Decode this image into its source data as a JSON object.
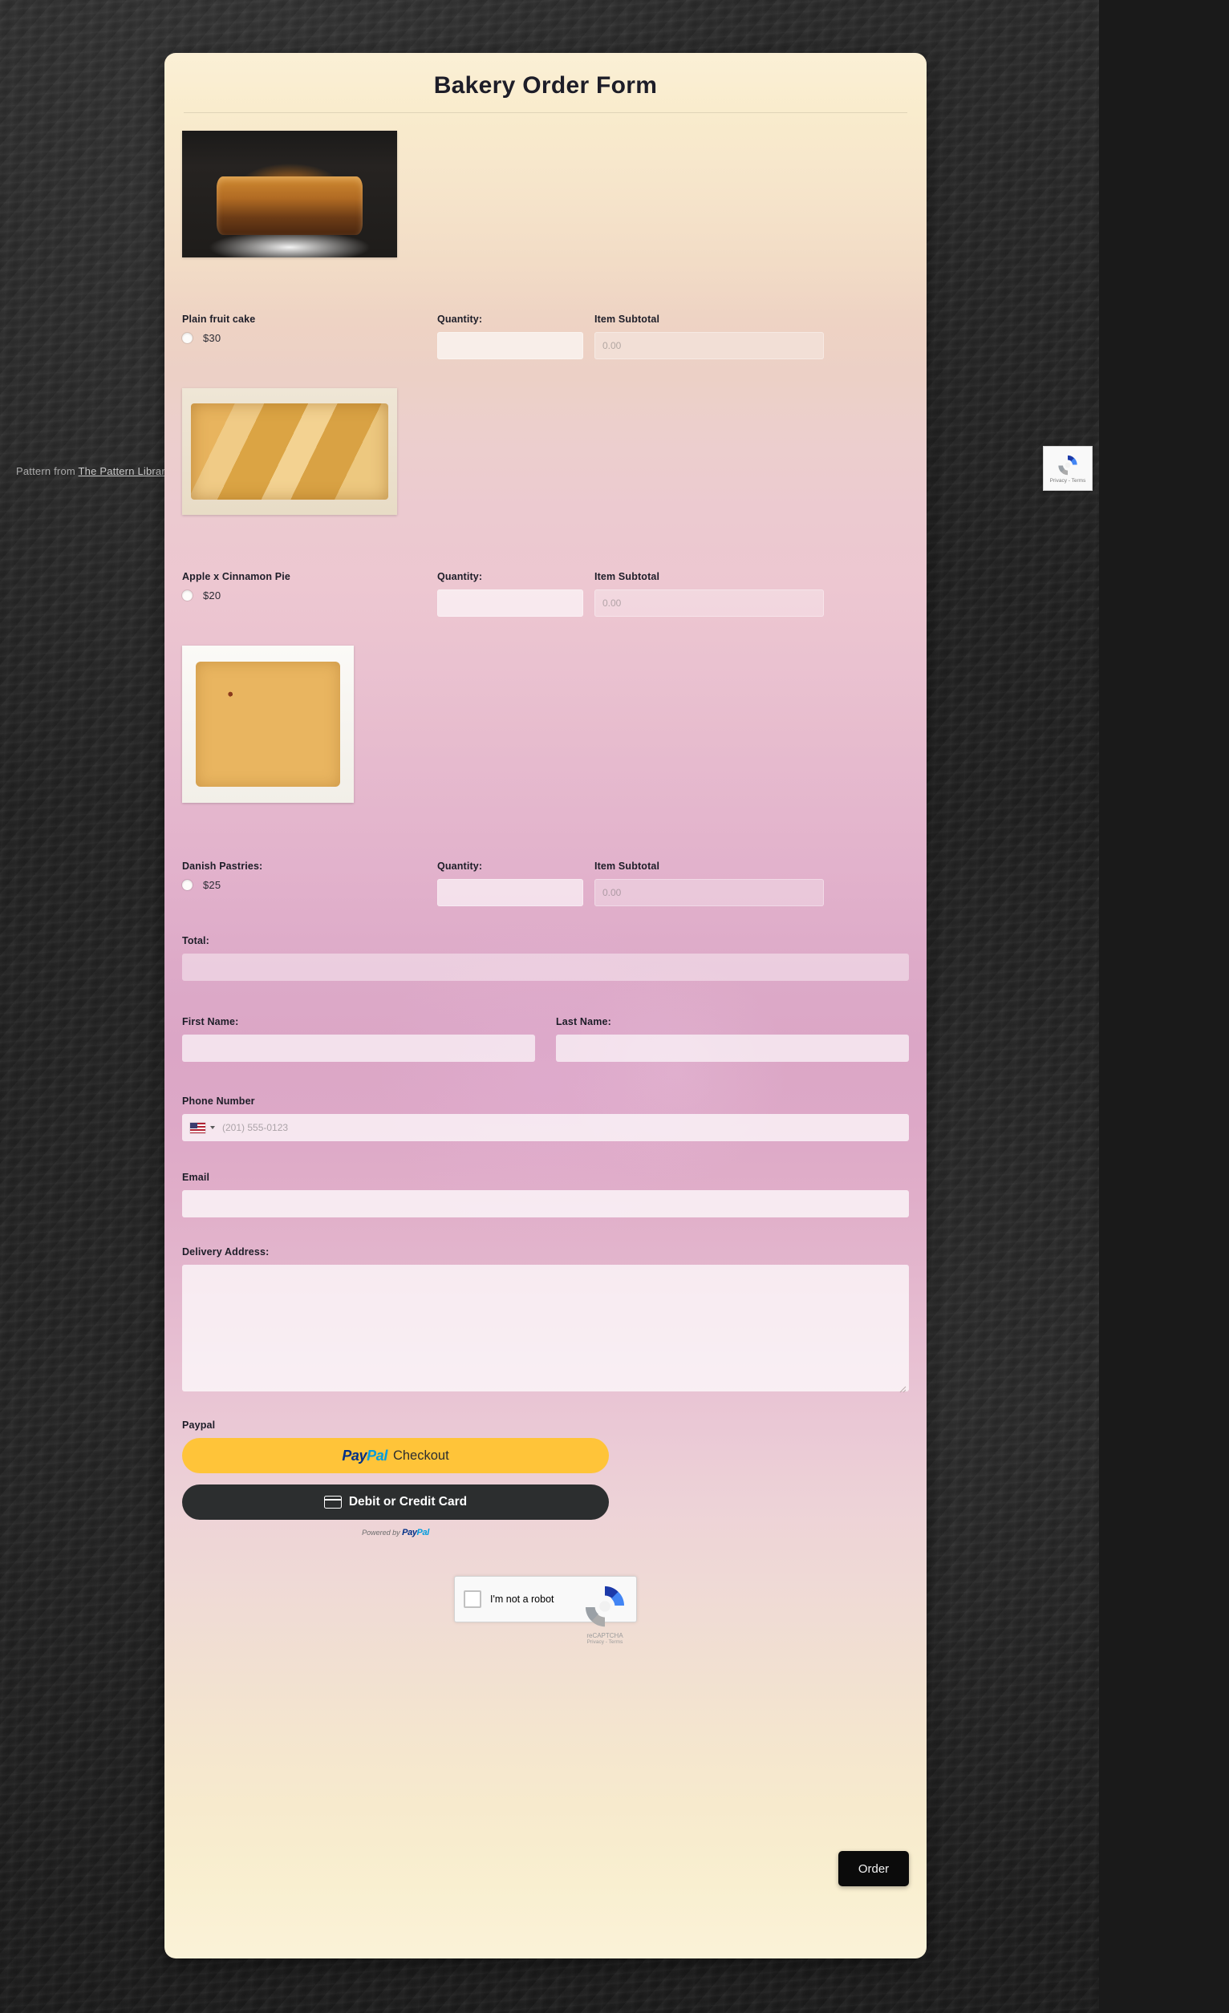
{
  "background": {
    "credit_prefix": "Pattern from ",
    "credit_link": "The Pattern Library",
    "recaptcha_badge_legal": "Privacy - Terms"
  },
  "form": {
    "title": "Bakery Order Form",
    "products": [
      {
        "name": "Plain fruit cake",
        "price": "$30",
        "photo": "plain-fruit-cake-photo",
        "quantity_label": "Quantity:",
        "quantity_value": "",
        "subtotal_label": "Item Subtotal",
        "subtotal_placeholder": "0.00",
        "subtotal_value": ""
      },
      {
        "name": "Apple x Cinnamon Pie",
        "price": "$20",
        "photo": "apple-cinnamon-pie-photo",
        "quantity_label": "Quantity:",
        "quantity_value": "",
        "subtotal_label": "Item Subtotal",
        "subtotal_placeholder": "0.00",
        "subtotal_value": ""
      },
      {
        "name": "Danish Pastries:",
        "price": "$25",
        "photo": "danish-pastries-photo",
        "quantity_label": "Quantity:",
        "quantity_value": "",
        "subtotal_label": "Item Subtotal",
        "subtotal_placeholder": "0.00",
        "subtotal_value": ""
      }
    ],
    "total": {
      "label": "Total:",
      "value": ""
    },
    "first_name": {
      "label": "First Name:",
      "value": ""
    },
    "last_name": {
      "label": "Last Name:",
      "value": ""
    },
    "phone": {
      "label": "Phone Number",
      "country_flag": "us-flag-icon",
      "placeholder": "(201) 555-0123",
      "value": ""
    },
    "email": {
      "label": "Email",
      "value": ""
    },
    "address": {
      "label": "Delivery Address:",
      "value": ""
    },
    "paypal": {
      "label": "Paypal",
      "checkout_brand_pay": "Pay",
      "checkout_brand_pal": "Pal",
      "checkout_label": "Checkout",
      "card_label": "Debit or Credit Card",
      "powered_prefix": "Powered by ",
      "powered_brand_pay": "Pay",
      "powered_brand_pal": "Pal"
    },
    "recaptcha": {
      "checkbox_label": "I'm not a robot",
      "brand": "reCAPTCHA",
      "legal": "Privacy - Terms"
    },
    "submit_label": "Order"
  },
  "colors": {
    "paypal_yellow": "#ffc439",
    "paypal_dark": "#2c2e2f",
    "paypal_blue_dark": "#003087",
    "paypal_blue_light": "#009cde",
    "order_button": "#0b0b0b",
    "card_top": "#fbf0d6",
    "card_middle": "#dba6c6"
  }
}
